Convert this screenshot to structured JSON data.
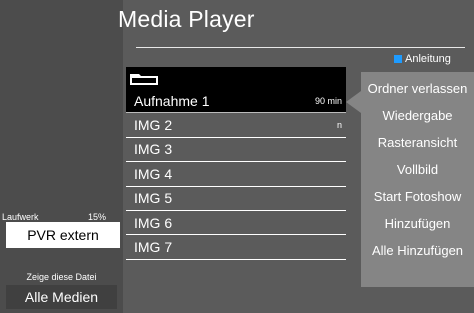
{
  "header": {
    "title": "Media Player",
    "help_label": "Anleitung"
  },
  "list": {
    "items": [
      {
        "name": "Aufnahme 1",
        "meta": "90 min"
      },
      {
        "name": "IMG 2",
        "meta": "n"
      },
      {
        "name": "IMG 3",
        "meta": ""
      },
      {
        "name": "IMG 4",
        "meta": ""
      },
      {
        "name": "IMG 5",
        "meta": ""
      },
      {
        "name": "IMG 6",
        "meta": ""
      },
      {
        "name": "IMG 7",
        "meta": ""
      }
    ]
  },
  "menu": {
    "items": [
      "Ordner verlassen",
      "Wiedergabe",
      "Rasteransicht",
      "Vollbild",
      "Start Fotoshow",
      "Hinzufügen",
      "Alle Hinzufügen"
    ]
  },
  "drive": {
    "label": "Laufwerk",
    "percent": "15%",
    "value": "PVR extern"
  },
  "filter": {
    "label": "Zeige diese Datei",
    "value": "Alle Medien"
  },
  "colors": {
    "help_key": "#1e9bff",
    "selection": "#000000",
    "menu_bg": "#858585"
  }
}
